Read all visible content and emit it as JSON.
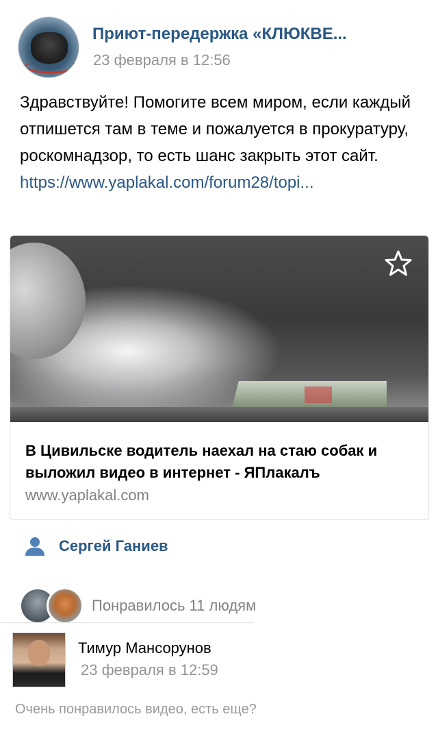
{
  "post": {
    "author": "Приют-передержка «КЛЮКВЕ...",
    "date": "23 февраля в 12:56",
    "text": "Здравствуйте! Помогите всем миром, если каждый отпишется там в теме и пожалуется в прокуратуру, роскомнадзор, то есть шанс закрыть этот сайт. ",
    "link_text": "https://www.yaplakal.com/forum28/topi...",
    "avatar_icon": "group-avatar",
    "link_color": "#2a5885"
  },
  "attachment": {
    "title": "В Цивильске водитель наехал на стаю собак и выложил видео в интернет - ЯПлакалъ",
    "domain": "www.yaplakal.com",
    "star_icon": "star-icon"
  },
  "signer": {
    "icon": "user-icon",
    "name": "Сергей Ганиев"
  },
  "likes": {
    "text": "Понравилось 11 людям",
    "count": 11
  },
  "comment": {
    "author": "Тимур Мансорунов",
    "date": "23 февраля в 12:59",
    "text": "Очень понравилось видео, есть еще?"
  }
}
